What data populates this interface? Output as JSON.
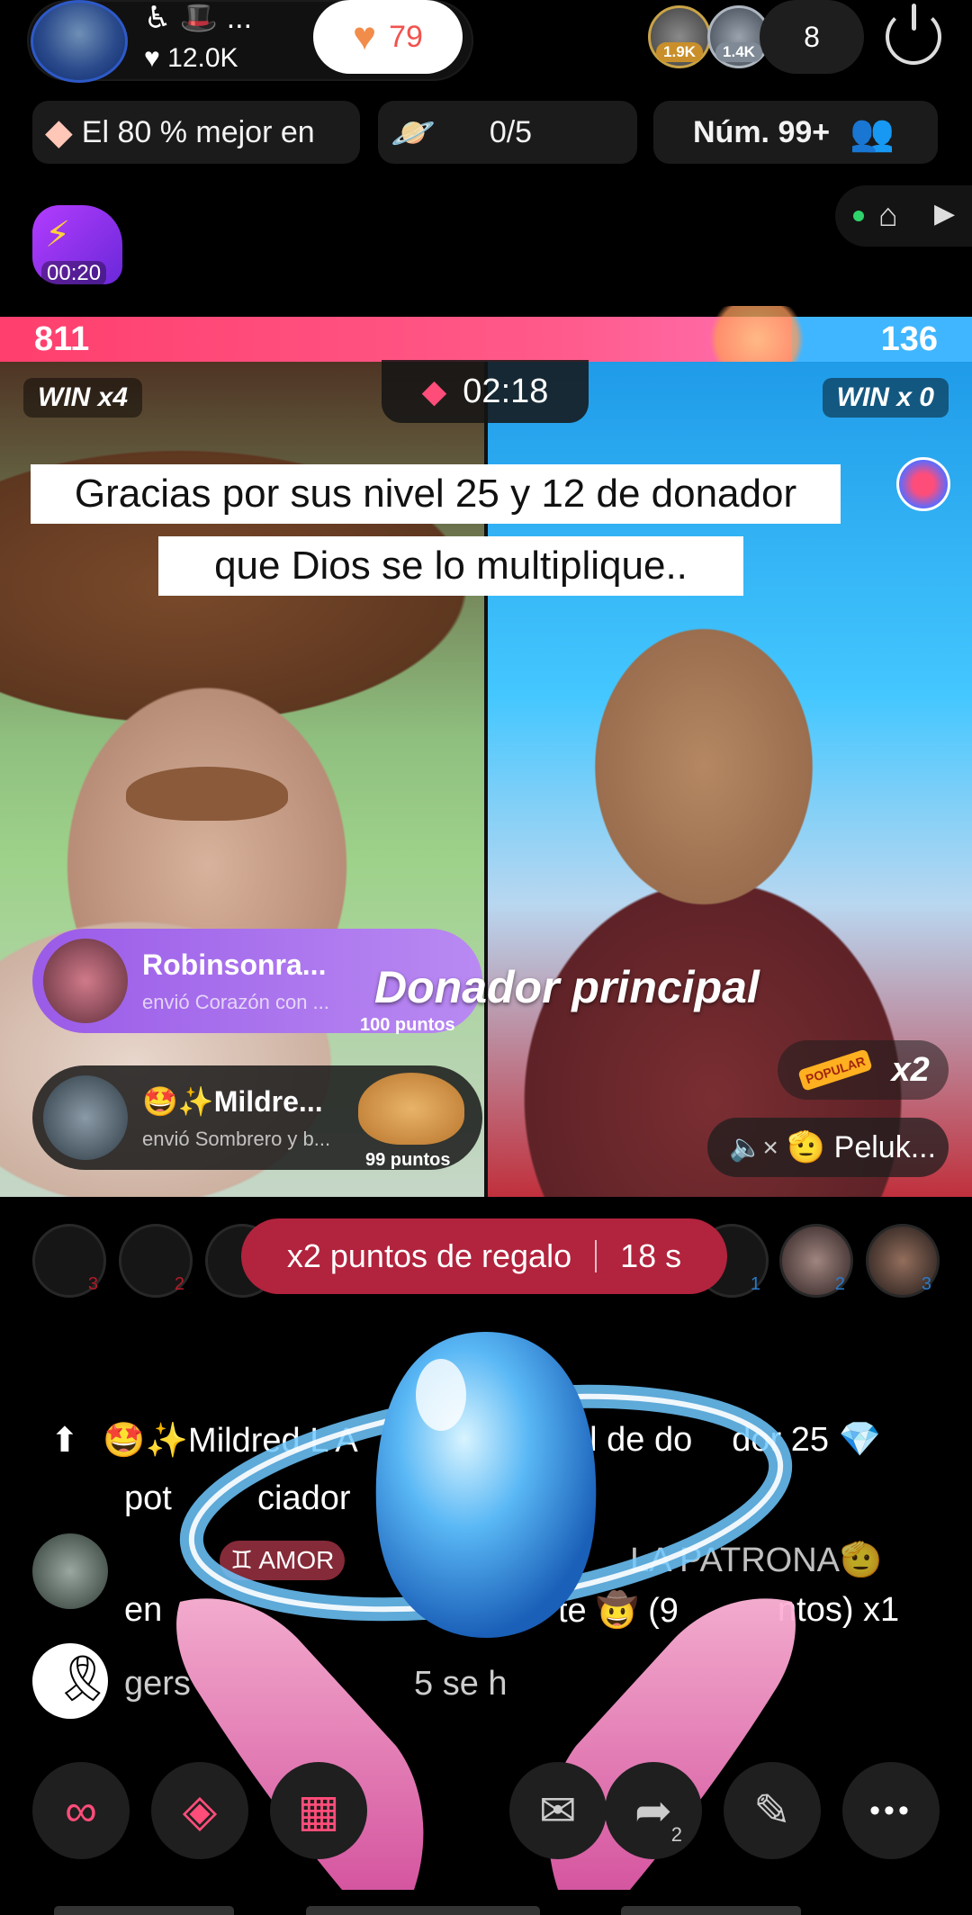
{
  "header": {
    "host_badges": "♿ 🎩 ...",
    "host_likes": "♥ 12.0K",
    "likes_button_count": "79",
    "viewer_badges": [
      "1.9K",
      "1.4K"
    ],
    "viewer_count": "8"
  },
  "chips": {
    "rank_label": "El 80 % mejor en",
    "planet_progress": "0/5",
    "number_label": "Núm. 99+"
  },
  "timer_tag": {
    "time": "00:20"
  },
  "battle": {
    "left_score": "811",
    "right_score": "136",
    "left_win": "WIN x4",
    "right_win": "WIN x 0",
    "timer": "02:18"
  },
  "caption": {
    "line1": "Gracias por sus nivel 25 y 12 de donador",
    "line2": "que Dios se lo multiplique.."
  },
  "gifts": [
    {
      "name": "Robinsonra...",
      "sent": "envió  Corazón con ...",
      "points": "100 puntos"
    },
    {
      "name": "🤩✨Mildre...",
      "sent": "envió  Sombrero y b...",
      "points": "99 puntos"
    }
  ],
  "donador_label": "Donador principal",
  "multiplier": {
    "badge": "POPULAR",
    "value": "x2"
  },
  "muted_guest": {
    "name": "🫡 Peluk..."
  },
  "ranking_marks": [
    "3",
    "2",
    "1",
    "2",
    "3"
  ],
  "bonus": {
    "label": "x2 puntos de regalo",
    "time": "18 s"
  },
  "chat": {
    "line1_arrow": "⬆",
    "line1_start": "🤩✨Mildred L A",
    "line1_end": "el de do",
    "line1_tail": "dor 25 💎",
    "line2": "pot",
    "line2_b": "ciador",
    "line3_badge": "♊ AMOR",
    "line3_name": "LA PATRONA🫡",
    "line4_a": "en",
    "line4_b": "te 🤠 (9",
    "line4_c": "ntos) x1",
    "line5_a": "gers",
    "line5_b": "5 se h"
  },
  "colors": {
    "left_team": "#ff4d7a",
    "right_team": "#3fb6ff",
    "bonus_pill": "#b2233d",
    "gift_card_1": "#a46cf0"
  },
  "toolbar_icons": [
    "link-icon",
    "battle-icon",
    "apps-icon",
    "comment-icon",
    "share-icon",
    "magic-wand-icon",
    "more-icon"
  ],
  "toolbar_share_count": "2",
  "toolbar_more_label": "•••"
}
